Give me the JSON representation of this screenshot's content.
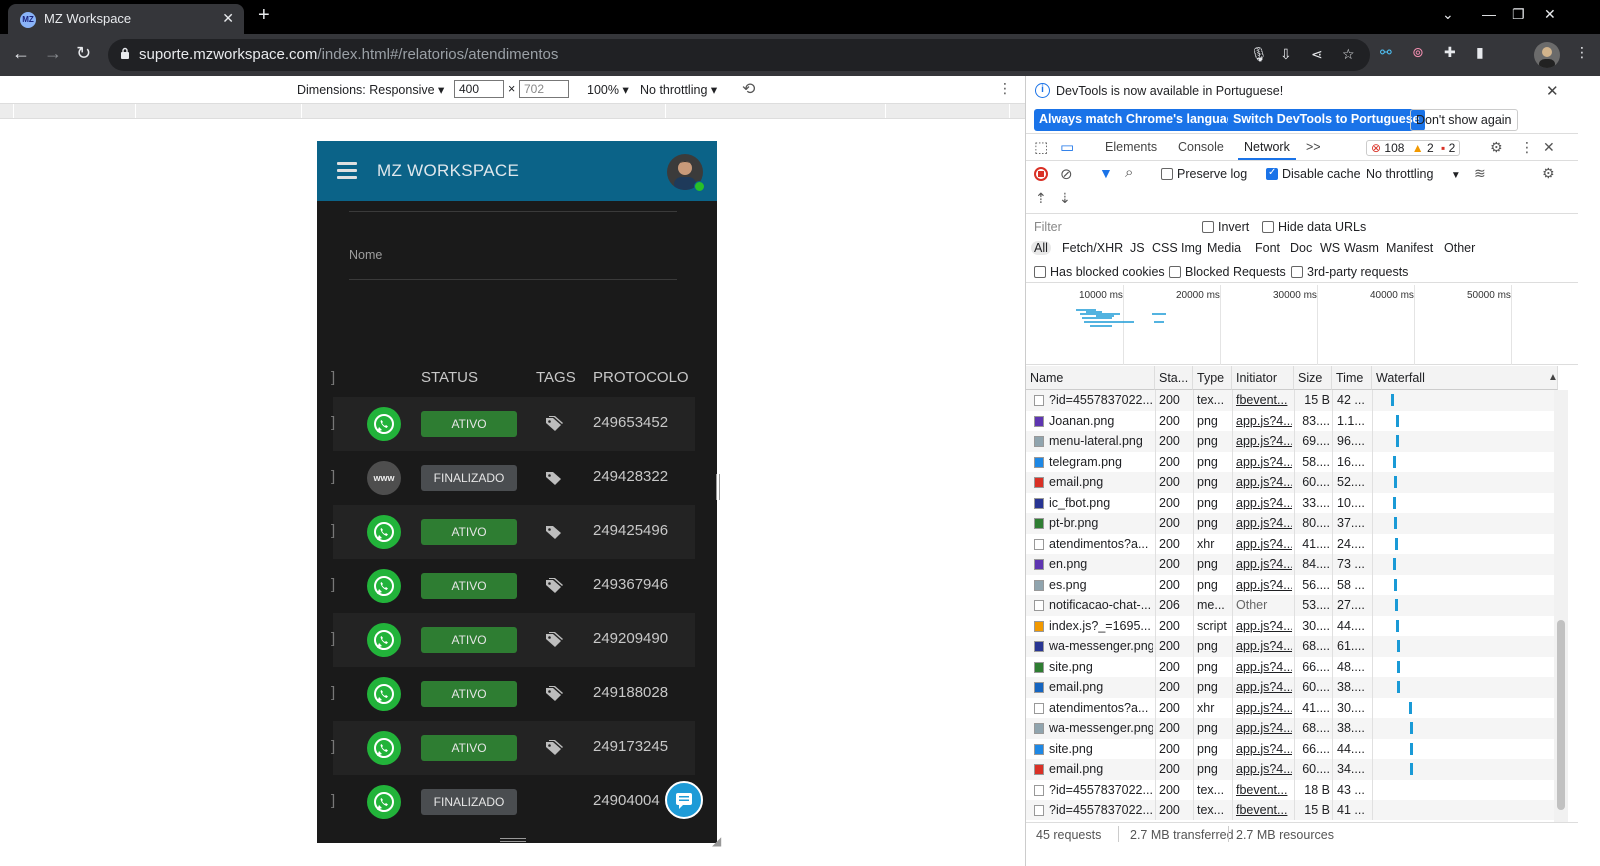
{
  "browser": {
    "tab_title": "MZ Workspace",
    "favicon_text": "MZ",
    "url_host": "suporte.mzworkspace.com",
    "url_path": "/index.html#/relatorios/atendimentos"
  },
  "device_toolbar": {
    "dimensions_label": "Dimensions: Responsive",
    "width": "400",
    "height": "702",
    "times": "×",
    "zoom": "100%",
    "throttling": "No throttling"
  },
  "app": {
    "brand": "MZ WORKSPACE",
    "nome_label": "Nome",
    "columns": {
      "status": "STATUS",
      "tags": "TAGS",
      "protocolo": "PROTOCOLO"
    },
    "rows": [
      {
        "channel": "whatsapp",
        "status": "ATIVO",
        "protocol": "249653452"
      },
      {
        "channel": "www",
        "channel_label": "www",
        "status": "FINALIZADO",
        "protocol": "249428322"
      },
      {
        "channel": "whatsapp",
        "status": "ATIVO",
        "protocol": "249425496"
      },
      {
        "channel": "whatsapp",
        "status": "ATIVO",
        "protocol": "249367946"
      },
      {
        "channel": "whatsapp",
        "status": "ATIVO",
        "protocol": "249209490"
      },
      {
        "channel": "whatsapp",
        "status": "ATIVO",
        "protocol": "249188028"
      },
      {
        "channel": "whatsapp",
        "status": "ATIVO",
        "protocol": "249173245"
      },
      {
        "channel": "whatsapp",
        "status": "FINALIZADO",
        "protocol": "24904004"
      }
    ],
    "colors": {
      "appbar": "#0b6388",
      "ativo": "#2e7d32",
      "finalizado": "#4a4d50",
      "whatsapp": "#22b33a"
    }
  },
  "devtools": {
    "info": {
      "message": "DevTools is now available in Portuguese!",
      "btn_match": "Always match Chrome's language",
      "btn_switch": "Switch DevTools to Portuguese",
      "btn_dismiss": "Don't show again"
    },
    "tabs": [
      "Elements",
      "Console",
      "Network"
    ],
    "more_tabs": ">>",
    "errors": "108",
    "warnings": "2",
    "issues": "2",
    "network_toolbar": {
      "preserve_log": "Preserve log",
      "disable_cache": "Disable cache",
      "throttling": "No throttling"
    },
    "filter": {
      "placeholder": "Filter",
      "invert": "Invert",
      "hide_data_urls": "Hide data URLs",
      "types": [
        "All",
        "Fetch/XHR",
        "JS",
        "CSS",
        "Img",
        "Media",
        "Font",
        "Doc",
        "WS",
        "Wasm",
        "Manifest",
        "Other"
      ],
      "has_blocked_cookies": "Has blocked cookies",
      "blocked_requests": "Blocked Requests",
      "third_party": "3rd-party requests"
    },
    "overview_ticks": [
      "10000 ms",
      "20000 ms",
      "30000 ms",
      "40000 ms",
      "50000 ms"
    ],
    "columns": [
      "Name",
      "Sta...",
      "Type",
      "Initiator",
      "Size",
      "Time",
      "Waterfall"
    ],
    "requests": [
      {
        "name": "?id=4557837022...",
        "status": "200",
        "type": "tex...",
        "initiator": "fbevent...",
        "size": "15 B",
        "time": "42 ...",
        "wf": 0.04
      },
      {
        "name": "Joanan.png",
        "status": "200",
        "type": "png",
        "initiator": "app.js?4...",
        "size": "83....",
        "time": "1.1...",
        "wf": 0.05
      },
      {
        "name": "menu-lateral.png",
        "status": "200",
        "type": "png",
        "initiator": "app.js?4...",
        "size": "69....",
        "time": "96....",
        "wf": 0.05
      },
      {
        "name": "telegram.png",
        "status": "200",
        "type": "png",
        "initiator": "app.js?4...",
        "size": "58....",
        "time": "16....",
        "wf": 0.045
      },
      {
        "name": "email.png",
        "status": "200",
        "type": "png",
        "initiator": "app.js?4...",
        "size": "60....",
        "time": "52....",
        "wf": 0.047
      },
      {
        "name": "ic_fbot.png",
        "status": "200",
        "type": "png",
        "initiator": "app.js?4...",
        "size": "33....",
        "time": "10....",
        "wf": 0.045
      },
      {
        "name": "pt-br.png",
        "status": "200",
        "type": "png",
        "initiator": "app.js?4...",
        "size": "80....",
        "time": "37....",
        "wf": 0.046
      },
      {
        "name": "atendimentos?a...",
        "status": "200",
        "type": "xhr",
        "initiator": "app.js?4...",
        "size": "41....",
        "time": "24....",
        "wf": 0.048
      },
      {
        "name": "en.png",
        "status": "200",
        "type": "png",
        "initiator": "app.js?4...",
        "size": "84....",
        "time": "73 ...",
        "wf": 0.045
      },
      {
        "name": "es.png",
        "status": "200",
        "type": "png",
        "initiator": "app.js?4...",
        "size": "56....",
        "time": "58 ...",
        "wf": 0.046
      },
      {
        "name": "notificacao-chat-...",
        "status": "206",
        "type": "me...",
        "initiator": "Other",
        "size": "53....",
        "time": "27....",
        "wf": 0.048
      },
      {
        "name": "index.js?_=1695...",
        "status": "200",
        "type": "script",
        "initiator": "app.js?4...",
        "size": "30....",
        "time": "44....",
        "wf": 0.052
      },
      {
        "name": "wa-messenger.png",
        "status": "200",
        "type": "png",
        "initiator": "app.js?4...",
        "size": "68....",
        "time": "61....",
        "wf": 0.053
      },
      {
        "name": "site.png",
        "status": "200",
        "type": "png",
        "initiator": "app.js?4...",
        "size": "66....",
        "time": "48....",
        "wf": 0.053
      },
      {
        "name": "email.png",
        "status": "200",
        "type": "png",
        "initiator": "app.js?4...",
        "size": "60....",
        "time": "38....",
        "wf": 0.054
      },
      {
        "name": "atendimentos?a...",
        "status": "200",
        "type": "xhr",
        "initiator": "app.js?4...",
        "size": "41....",
        "time": "30....",
        "wf": 0.078
      },
      {
        "name": "wa-messenger.png",
        "status": "200",
        "type": "png",
        "initiator": "app.js?4...",
        "size": "68....",
        "time": "38....",
        "wf": 0.08
      },
      {
        "name": "site.png",
        "status": "200",
        "type": "png",
        "initiator": "app.js?4...",
        "size": "66....",
        "time": "44....",
        "wf": 0.08
      },
      {
        "name": "email.png",
        "status": "200",
        "type": "png",
        "initiator": "app.js?4...",
        "size": "60....",
        "time": "34....",
        "wf": 0.08
      },
      {
        "name": "?id=4557837022...",
        "status": "200",
        "type": "tex...",
        "initiator": "fbevent...",
        "size": "18 B",
        "time": "43 ...",
        "wf": null
      },
      {
        "name": "?id=4557837022...",
        "status": "200",
        "type": "tex...",
        "initiator": "fbevent...",
        "size": "15 B",
        "time": "41 ...",
        "wf": null
      }
    ],
    "summary": {
      "requests": "45 requests",
      "transferred": "2.7 MB transferred",
      "resources": "2.7 MB resources"
    }
  }
}
